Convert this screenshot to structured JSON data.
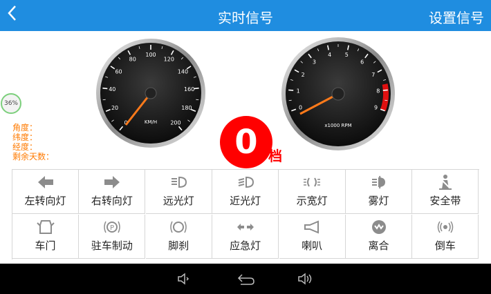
{
  "header": {
    "back_icon": "chevron-left-icon",
    "title": "实时信号",
    "settings_label": "设置信号"
  },
  "battery": {
    "value": "36%"
  },
  "info": {
    "angle_label": "角度：",
    "lat_label": "纬度：",
    "lon_label": "经度：",
    "remaining_label": "剩余天数："
  },
  "speedometer": {
    "unit": "KM/H",
    "ticks": [
      "0",
      "20",
      "40",
      "60",
      "80",
      "100",
      "120",
      "140",
      "160",
      "180",
      "200"
    ],
    "value": 0
  },
  "tachometer": {
    "unit": "x1000 RPM",
    "ticks": [
      "0",
      "1",
      "2",
      "3",
      "4",
      "5",
      "6",
      "7",
      "8",
      "9"
    ],
    "value": 0,
    "redline_from": 7.7
  },
  "gear": {
    "value": "0",
    "label": "档"
  },
  "signals": [
    {
      "label": "左转向灯",
      "icon": "left-turn-arrow-icon"
    },
    {
      "label": "右转向灯",
      "icon": "right-turn-arrow-icon"
    },
    {
      "label": "远光灯",
      "icon": "high-beam-icon"
    },
    {
      "label": "近光灯",
      "icon": "low-beam-icon"
    },
    {
      "label": "示宽灯",
      "icon": "position-light-icon"
    },
    {
      "label": "雾灯",
      "icon": "fog-light-icon"
    },
    {
      "label": "安全带",
      "icon": "seatbelt-icon"
    },
    {
      "label": "车门",
      "icon": "car-door-icon"
    },
    {
      "label": "驻车制动",
      "icon": "parking-brake-icon"
    },
    {
      "label": "脚刹",
      "icon": "foot-brake-icon"
    },
    {
      "label": "应急灯",
      "icon": "hazard-light-icon"
    },
    {
      "label": "喇叭",
      "icon": "horn-icon"
    },
    {
      "label": "离合",
      "icon": "clutch-icon"
    },
    {
      "label": "倒车",
      "icon": "reverse-icon"
    }
  ],
  "nav": {
    "vol_down_icon": "volume-down-icon",
    "back_icon": "back-icon",
    "vol_up_icon": "volume-up-icon"
  }
}
